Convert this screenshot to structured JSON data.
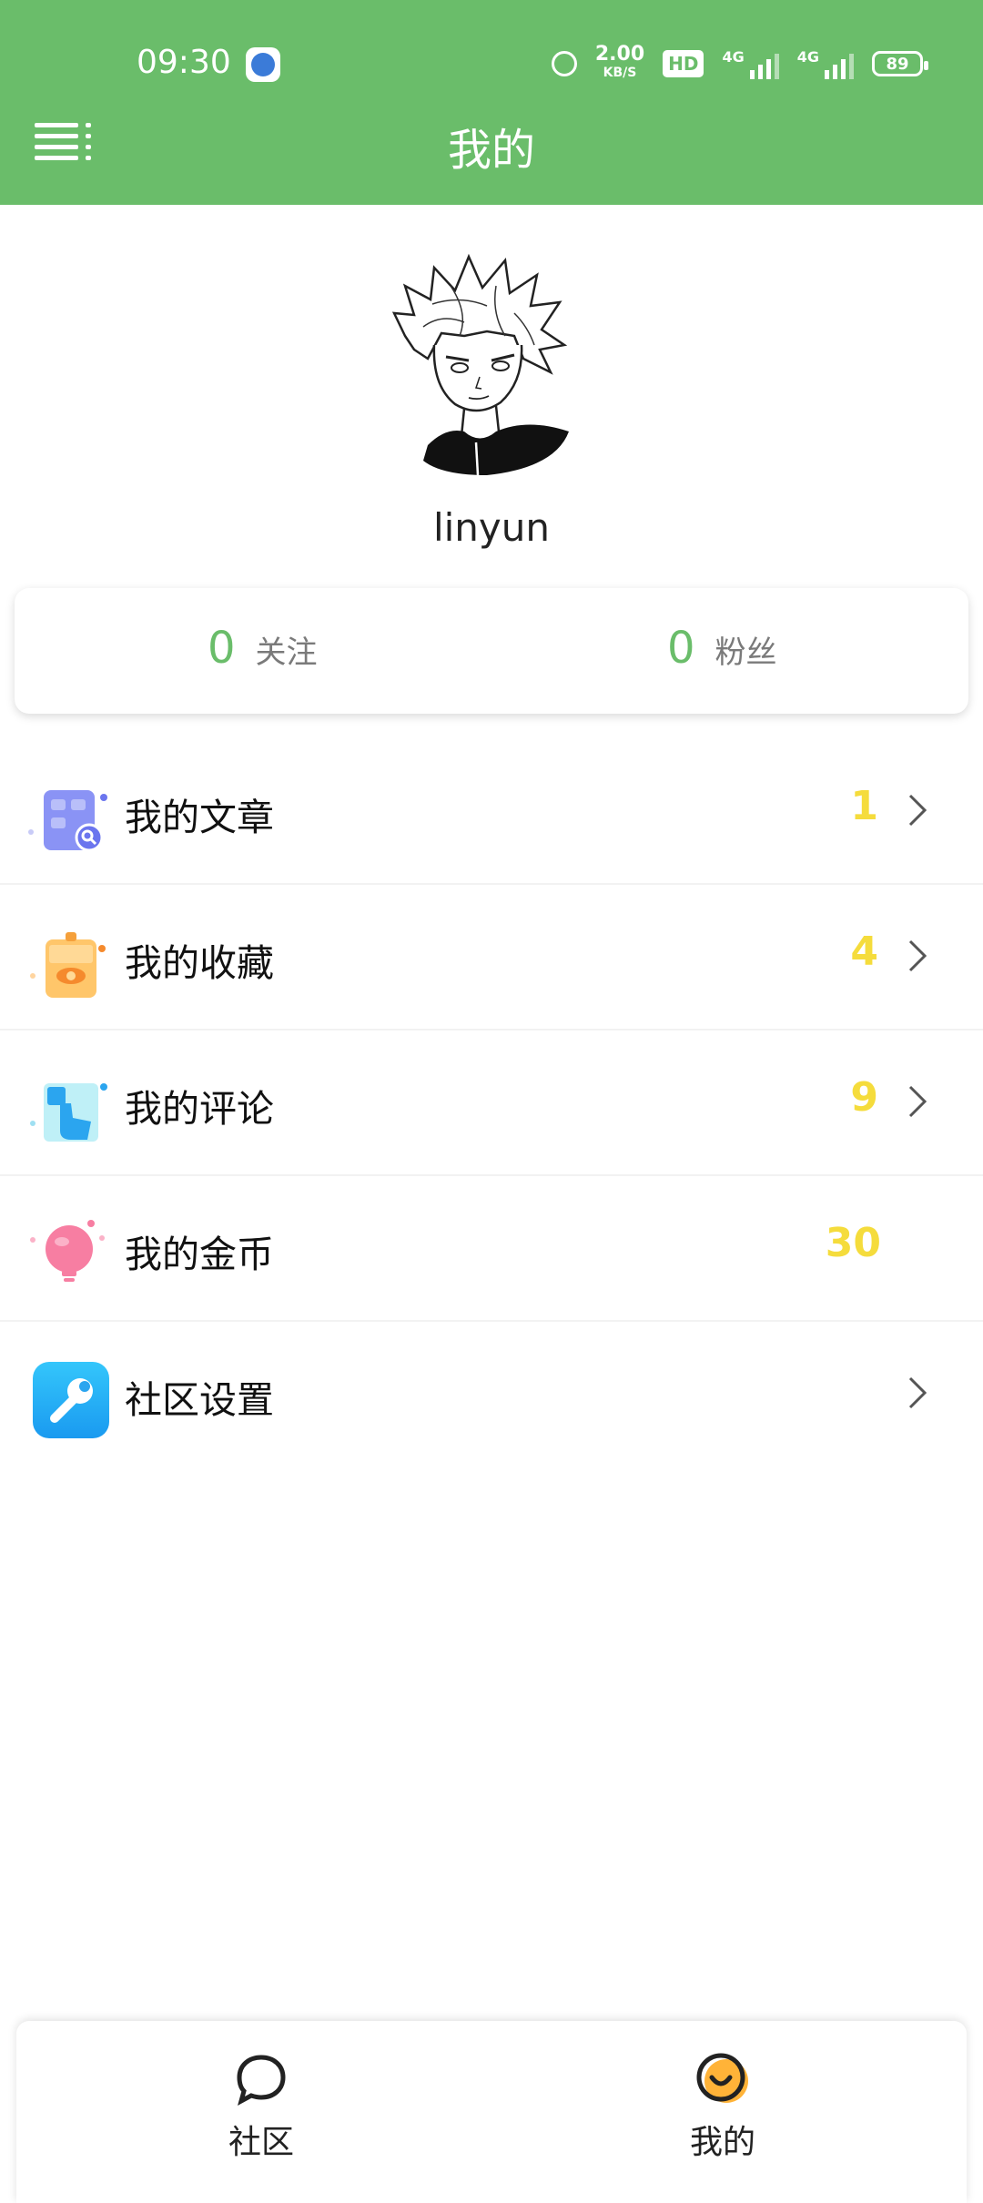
{
  "status_bar": {
    "time": "09:30",
    "speed_value": "2.00",
    "speed_unit": "KB/S",
    "hd_label": "HD",
    "signal1_label": "4G",
    "signal2_label": "4G",
    "battery": "89"
  },
  "header": {
    "title": "我的"
  },
  "profile": {
    "username": "linyun"
  },
  "stats": {
    "following_count": "0",
    "following_label": "关注",
    "followers_count": "0",
    "followers_label": "粉丝"
  },
  "menu": {
    "items": [
      {
        "label": "我的文章",
        "count": "1",
        "icon": "articles-icon"
      },
      {
        "label": "我的收藏",
        "count": "4",
        "icon": "favorites-icon"
      },
      {
        "label": "我的评论",
        "count": "9",
        "icon": "comments-icon"
      },
      {
        "label": "我的金币",
        "count": "30",
        "icon": "coins-icon"
      },
      {
        "label": "社区设置",
        "count": "",
        "icon": "settings-icon"
      }
    ]
  },
  "bottom_nav": {
    "community_label": "社区",
    "mine_label": "我的"
  },
  "colors": {
    "brand_green": "#6abd6a",
    "count_yellow": "#f5dc3c"
  }
}
